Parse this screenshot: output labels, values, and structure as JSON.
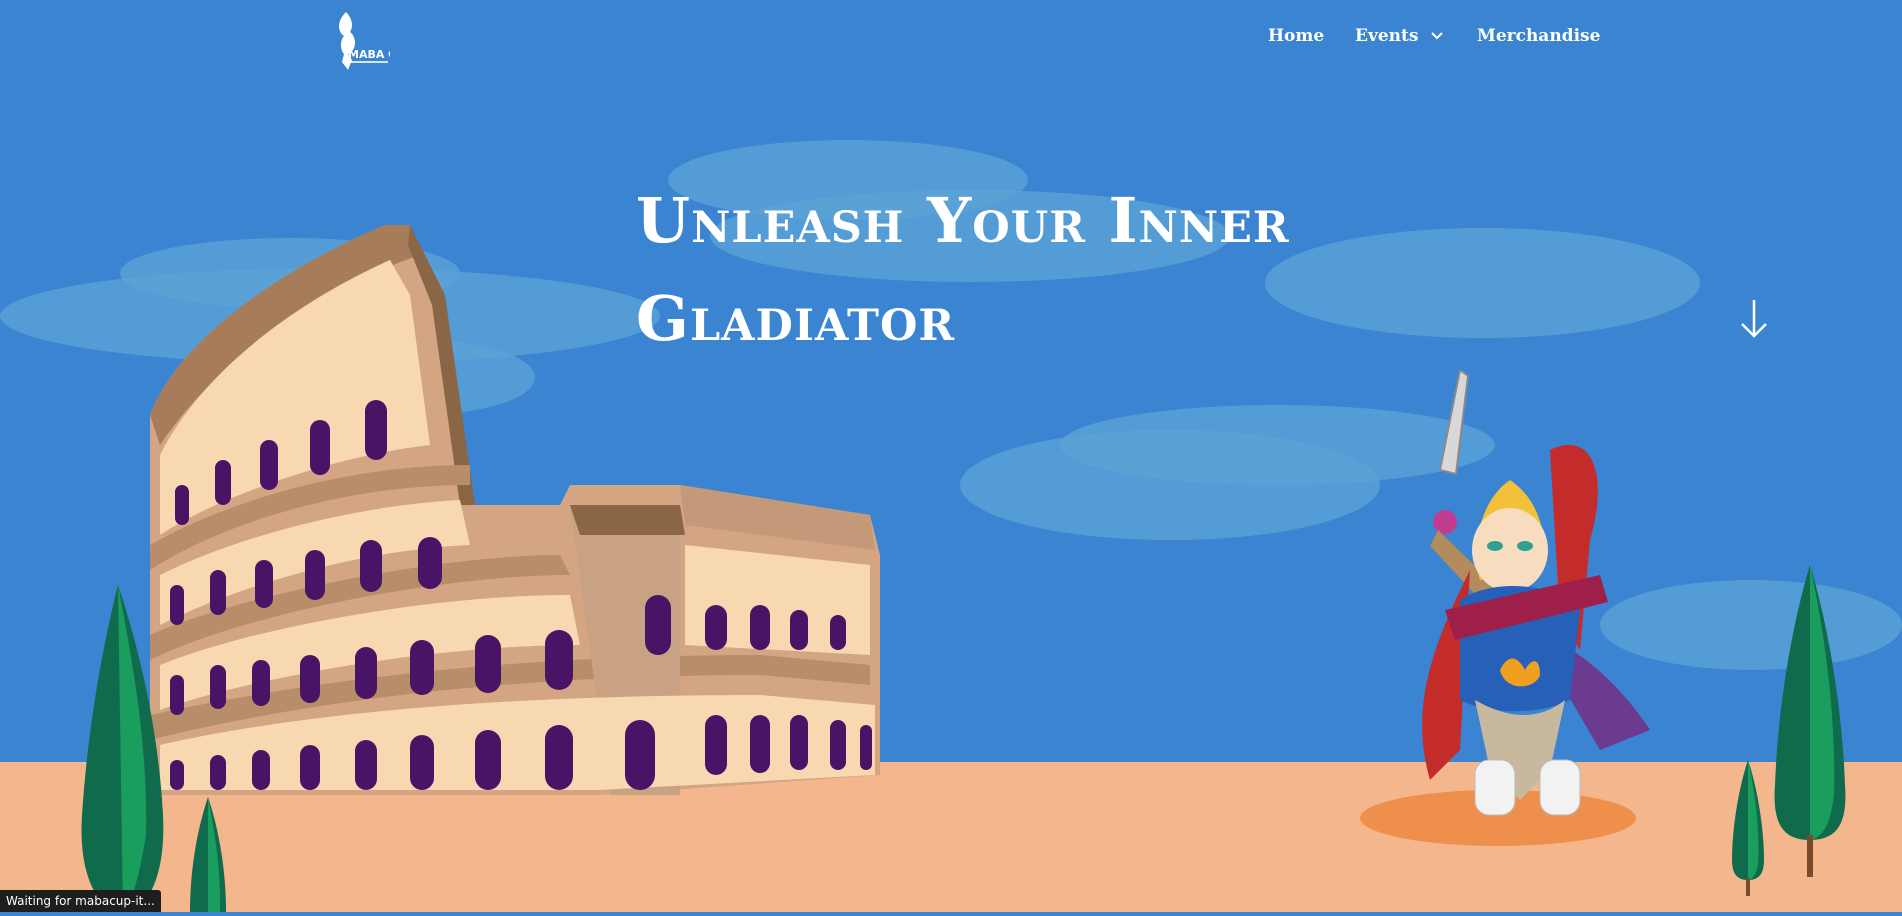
{
  "header": {
    "logo_text": "MABA CUP",
    "nav": {
      "home": "Home",
      "events": "Events",
      "merchandise": "Merchandise"
    }
  },
  "hero": {
    "title_line1": "Unleash Your Inner",
    "title_line2": "Gladiator"
  },
  "status_bar": {
    "text": "Waiting for mabacup-it..."
  },
  "colors": {
    "sky": "#3a84d1",
    "ground": "#f4b68d",
    "text": "#ffffff"
  },
  "icons": {
    "logo": "maba-cup-logo-icon",
    "events_dropdown": "chevron-down-icon",
    "scroll": "arrow-down-icon"
  }
}
